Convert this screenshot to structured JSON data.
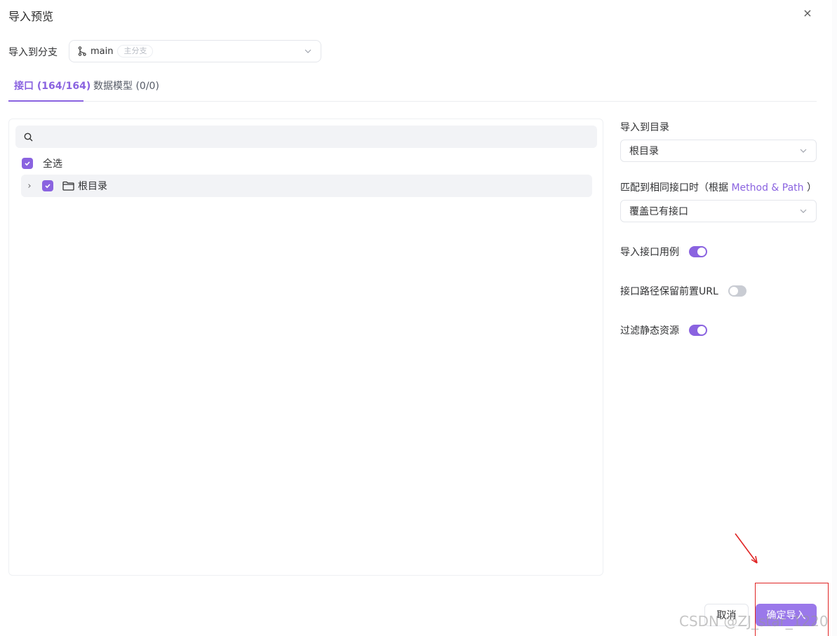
{
  "dialog": {
    "title": "导入预览",
    "close_symbol": "×"
  },
  "branch": {
    "label": "导入到分支",
    "name": "main",
    "tag": "主分支"
  },
  "tabs": [
    {
      "label": "接口 (164/164)",
      "active": true
    },
    {
      "label": "数据模型 (0/0)",
      "active": false
    }
  ],
  "tree": {
    "search": {
      "placeholder": "",
      "value": ""
    },
    "select_all_label": "全选",
    "root_label": "根目录",
    "select_all_checked": true,
    "root_checked": true,
    "expand_symbol": "›"
  },
  "settings": {
    "target_dir": {
      "label": "导入到目录",
      "value": "根目录"
    },
    "match": {
      "label_prefix": "匹配到相同接口时（根据 ",
      "label_accent": "Method & Path",
      "label_suffix": " ）",
      "value": "覆盖已有接口"
    },
    "toggles": [
      {
        "label": "导入接口用例",
        "on": true
      },
      {
        "label": "接口路径保留前置URL",
        "on": false
      },
      {
        "label": "过滤静态资源",
        "on": true
      }
    ]
  },
  "footer": {
    "cancel_label": "取消",
    "confirm_label": "确定导入"
  },
  "watermark": "CSDN @ZJ_star_1220",
  "colors": {
    "accent": "#8a63e0",
    "confirm_bg": "#9a78ea",
    "annotation_red": "#e02424"
  },
  "icons": [
    "close-icon",
    "branch-icon",
    "chevron-down-icon",
    "search-icon",
    "check-icon",
    "folder-icon"
  ]
}
